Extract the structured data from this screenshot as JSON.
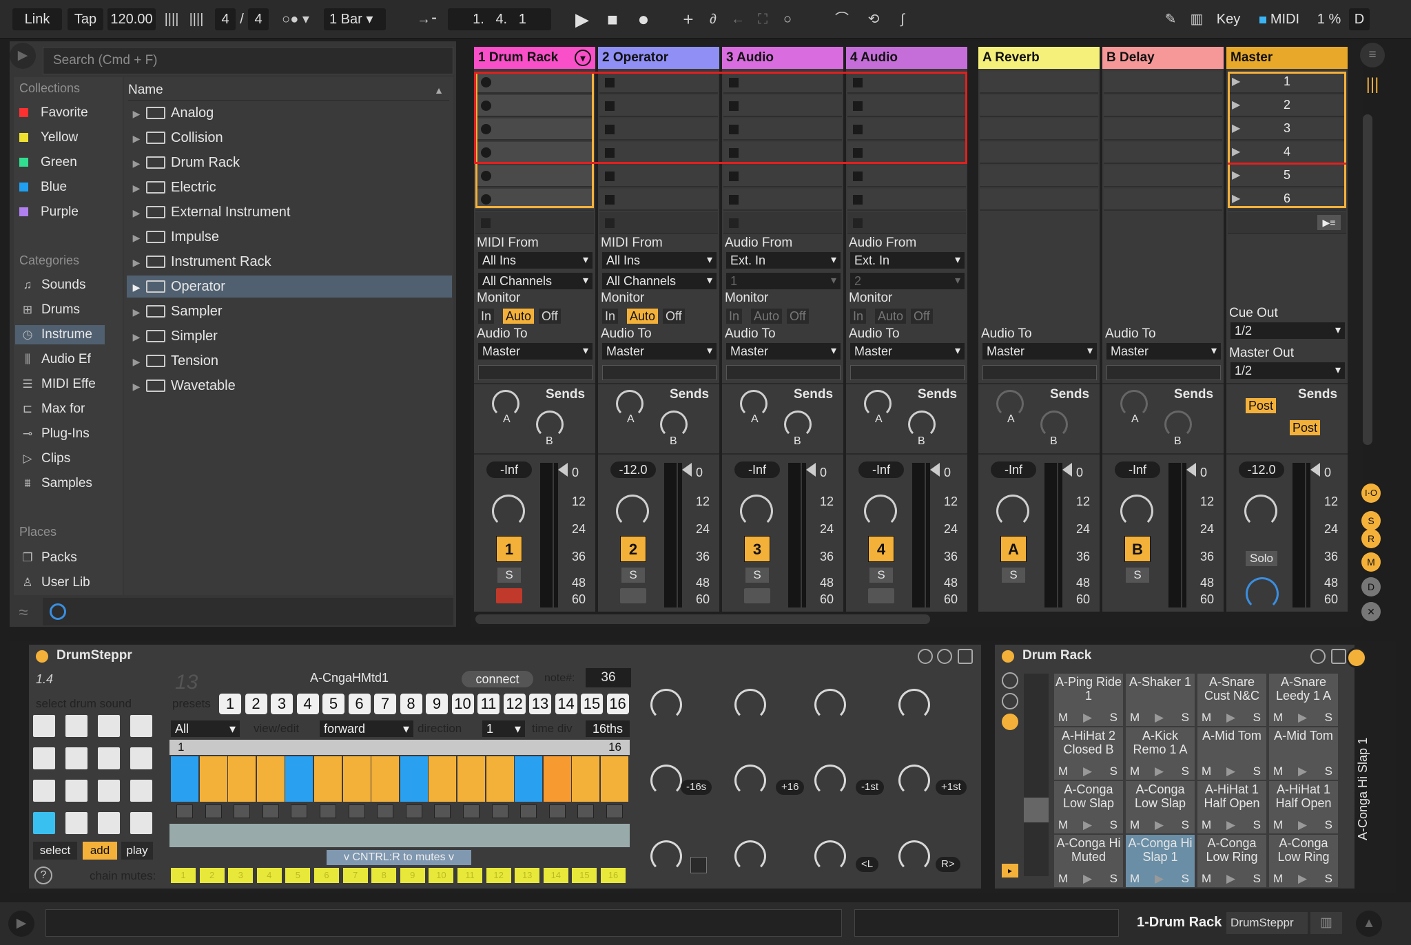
{
  "toolbar": {
    "link": "Link",
    "tap": "Tap",
    "tempo": "120.00",
    "sig_num": "4",
    "sig_sep": "/",
    "sig_den": "4",
    "quant": "1 Bar",
    "pos1": "1.",
    "pos2": "4.",
    "pos3": "1",
    "key": "Key",
    "midi": "MIDI",
    "cpu": "1 %",
    "d": "D"
  },
  "browser": {
    "search_placeholder": "Search (Cmd + F)",
    "collections_head": "Collections",
    "collections": [
      {
        "label": "Favorite",
        "color": "#ff3030"
      },
      {
        "label": "Yellow",
        "color": "#f0e030"
      },
      {
        "label": "Green",
        "color": "#30e090"
      },
      {
        "label": "Blue",
        "color": "#20a0f0"
      },
      {
        "label": "Purple",
        "color": "#b080f0"
      }
    ],
    "categories_head": "Categories",
    "categories": [
      "Sounds",
      "Drums",
      "Instrume",
      "Audio Ef",
      "MIDI Effe",
      "Max for",
      "Plug-Ins",
      "Clips",
      "Samples"
    ],
    "places_head": "Places",
    "places": [
      "Packs",
      "User Lib"
    ],
    "name_col": "Name",
    "files": [
      "Analog",
      "Collision",
      "Drum Rack",
      "Electric",
      "External Instrument",
      "Impulse",
      "Instrument Rack",
      "Operator",
      "Sampler",
      "Simpler",
      "Tension",
      "Wavetable"
    ]
  },
  "tracks": [
    {
      "name": "1 Drum Rack",
      "color": "#f94fc8",
      "from": "MIDI From",
      "in": "All Ins",
      "ch": "All Channels",
      "vol": "-Inf",
      "num": "1"
    },
    {
      "name": "2 Operator",
      "color": "#8f8ff5",
      "from": "MIDI From",
      "in": "All Ins",
      "ch": "All Channels",
      "vol": "-12.0",
      "num": "2"
    },
    {
      "name": "3 Audio",
      "color": "#d96de0",
      "from": "Audio From",
      "in": "Ext. In",
      "ch": "1",
      "vol": "-Inf",
      "num": "3"
    },
    {
      "name": "4 Audio",
      "color": "#c56ed9",
      "from": "Audio From",
      "in": "Ext. In",
      "ch": "2",
      "vol": "-Inf",
      "num": "4"
    },
    {
      "name": "A Reverb",
      "color": "#f5f07a",
      "vol": "-Inf",
      "num": "A"
    },
    {
      "name": "B Delay",
      "color": "#f79898",
      "vol": "-Inf",
      "num": "B"
    },
    {
      "name": "Master",
      "color": "#e8a92a",
      "vol": "-12.0"
    }
  ],
  "mixer_labels": {
    "monitor": "Monitor",
    "in": "In",
    "auto": "Auto",
    "off": "Off",
    "audio_to": "Audio To",
    "master": "Master",
    "sends": "Sends",
    "a": "A",
    "b": "B",
    "s": "S",
    "cue_out": "Cue Out",
    "master_out": "Master Out",
    "half": "1/2",
    "post": "Post",
    "solo": "Solo"
  },
  "scale": [
    "0",
    "12",
    "24",
    "36",
    "48",
    "60"
  ],
  "scenes": [
    "1",
    "2",
    "3",
    "4",
    "5",
    "6"
  ],
  "drumsteppr": {
    "title": "DrumSteppr",
    "version": "1.4",
    "big_num": "13",
    "sound": "A-CngaHMtd1",
    "connect": "connect",
    "note_label": "note#:",
    "note": "36",
    "select": "select drum sound",
    "presets": "presets",
    "view_all": "All",
    "view_edit": "view/edit",
    "forward": "forward",
    "direction": "direction",
    "time_one": "1",
    "time_div": "time div",
    "sixteenths": "16ths",
    "range_start": "1",
    "range_end": "16",
    "mute_text": "v CNTRL:R to mutes v",
    "chain_mutes": "chain mutes:",
    "btn_select": "select",
    "btn_add": "add",
    "btn_play": "play",
    "help": "?",
    "knob_labels": [
      "-16s",
      "+16",
      "-1st",
      "+1st",
      "<L",
      "R>"
    ]
  },
  "drumrack": {
    "title": "Drum Rack",
    "side": "A-Conga Hi Slap 1",
    "pads": [
      [
        "A-Ping Ride 1",
        "A-Shaker 1",
        "A-Snare Cust N&C",
        "A-Snare Leedy 1 A"
      ],
      [
        "A-HiHat 2 Closed B",
        "A-Kick Remo 1 A",
        "A-Mid Tom",
        "A-Mid Tom"
      ],
      [
        "A-Conga Low Slap",
        "A-Conga Low Slap",
        "A-HiHat 1 Half Open",
        "A-HiHat 1 Half Open"
      ],
      [
        "A-Conga Hi Muted",
        "A-Conga Hi Slap 1",
        "A-Conga Low Ring",
        "A-Conga Low Ring"
      ]
    ]
  },
  "statusbar": {
    "track": "1-Drum Rack",
    "device": "DrumSteppr"
  }
}
